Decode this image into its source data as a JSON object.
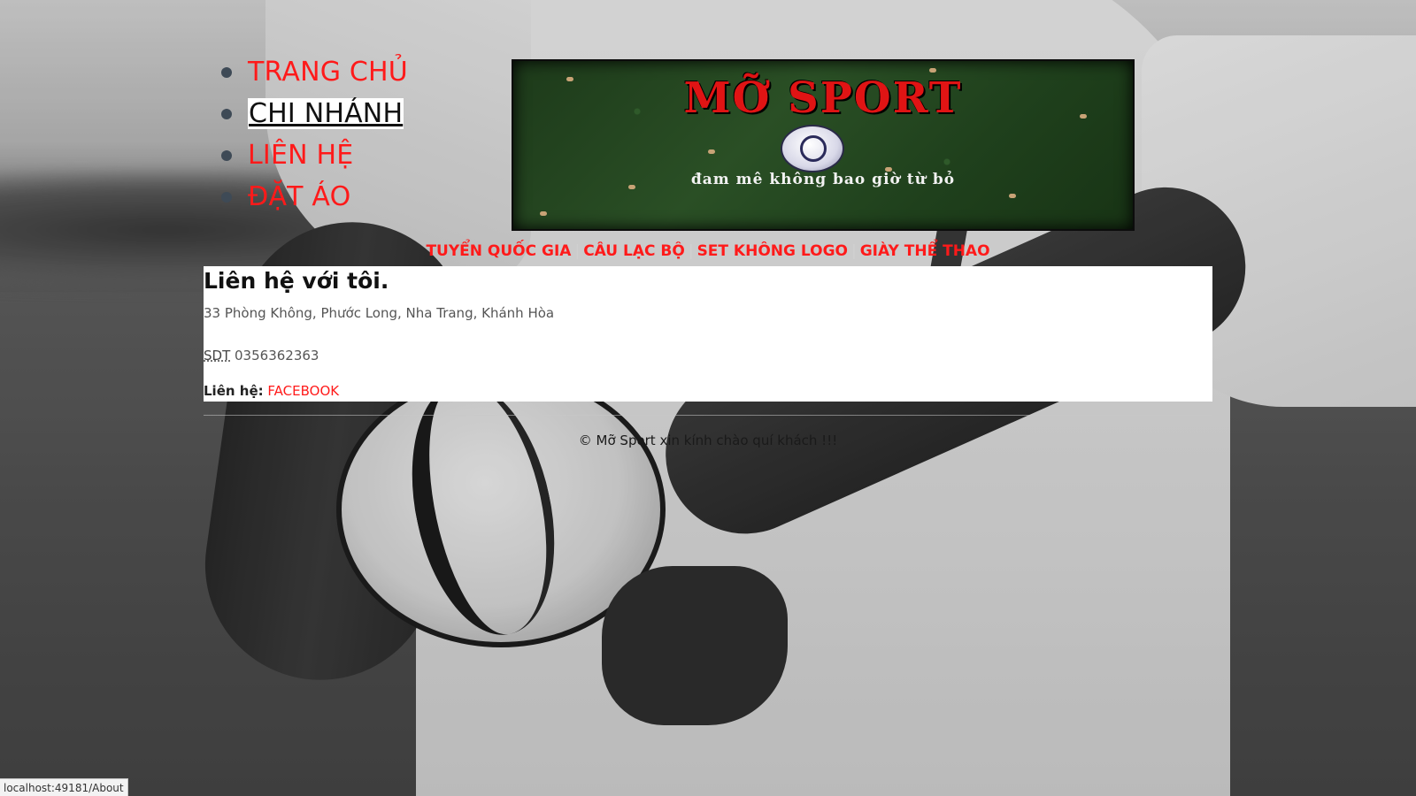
{
  "nav": {
    "items": [
      {
        "label": "TRANG CHỦ",
        "active": false
      },
      {
        "label": "CHI NHÁNH",
        "active": true
      },
      {
        "label": "LIÊN HỆ",
        "active": false
      },
      {
        "label": "ĐẶT ÁO",
        "active": false
      }
    ]
  },
  "banner": {
    "brand": "MỠ SPORT",
    "slogan": "đam mê không bao giờ từ bỏ"
  },
  "categories": {
    "items": [
      "TUYỂN QUỐC GIA",
      "CÂU LẠC BỘ",
      "SET KHÔNG LOGO",
      "GIÀY THỂ THAO"
    ],
    "separator": "|"
  },
  "contact": {
    "heading": "Liên hệ với tôi.",
    "address": "33 Phòng Không, Phước Long, Nha Trang, Khánh Hòa",
    "phone_label": "SDT",
    "phone": "0356362363",
    "contact_label": "Liên hệ:",
    "contact_link": "FACEBOOK"
  },
  "footer": {
    "text": "© Mỡ Sport xin kính chào quí khách !!!"
  },
  "statusbar": {
    "url": "localhost:49181/About"
  },
  "colors": {
    "link": "#ff1a1a",
    "active_bg": "#ffffff",
    "active_text": "#111111"
  }
}
